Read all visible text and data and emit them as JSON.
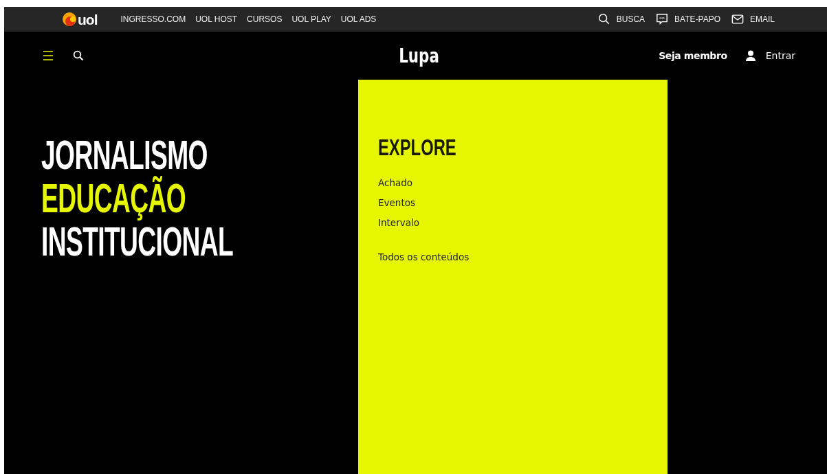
{
  "top_bar": {
    "logo": "uol",
    "links": [
      "INGRESSO.COM",
      "UOL HOST",
      "CURSOS",
      "UOL PLAY",
      "UOL ADS"
    ],
    "actions": [
      {
        "kind": "search",
        "label": "BUSCA"
      },
      {
        "kind": "chat",
        "label": "BATE-PAPO"
      },
      {
        "kind": "mail",
        "label": "EMAIL"
      }
    ]
  },
  "header": {
    "title": "Lupa",
    "member": "Seja membro",
    "login": "Entrar"
  },
  "headline": [
    {
      "text": "JORNALISMO",
      "highlighted": false
    },
    {
      "text": "EDUCAÇÃO",
      "highlighted": true
    },
    {
      "text": "INSTITUCIONAL",
      "highlighted": false
    }
  ],
  "explore": {
    "title": "EXPLORE",
    "items": [
      "Achado",
      "Eventos",
      "Intervalo"
    ],
    "all": "Todos os conteúdos"
  }
}
